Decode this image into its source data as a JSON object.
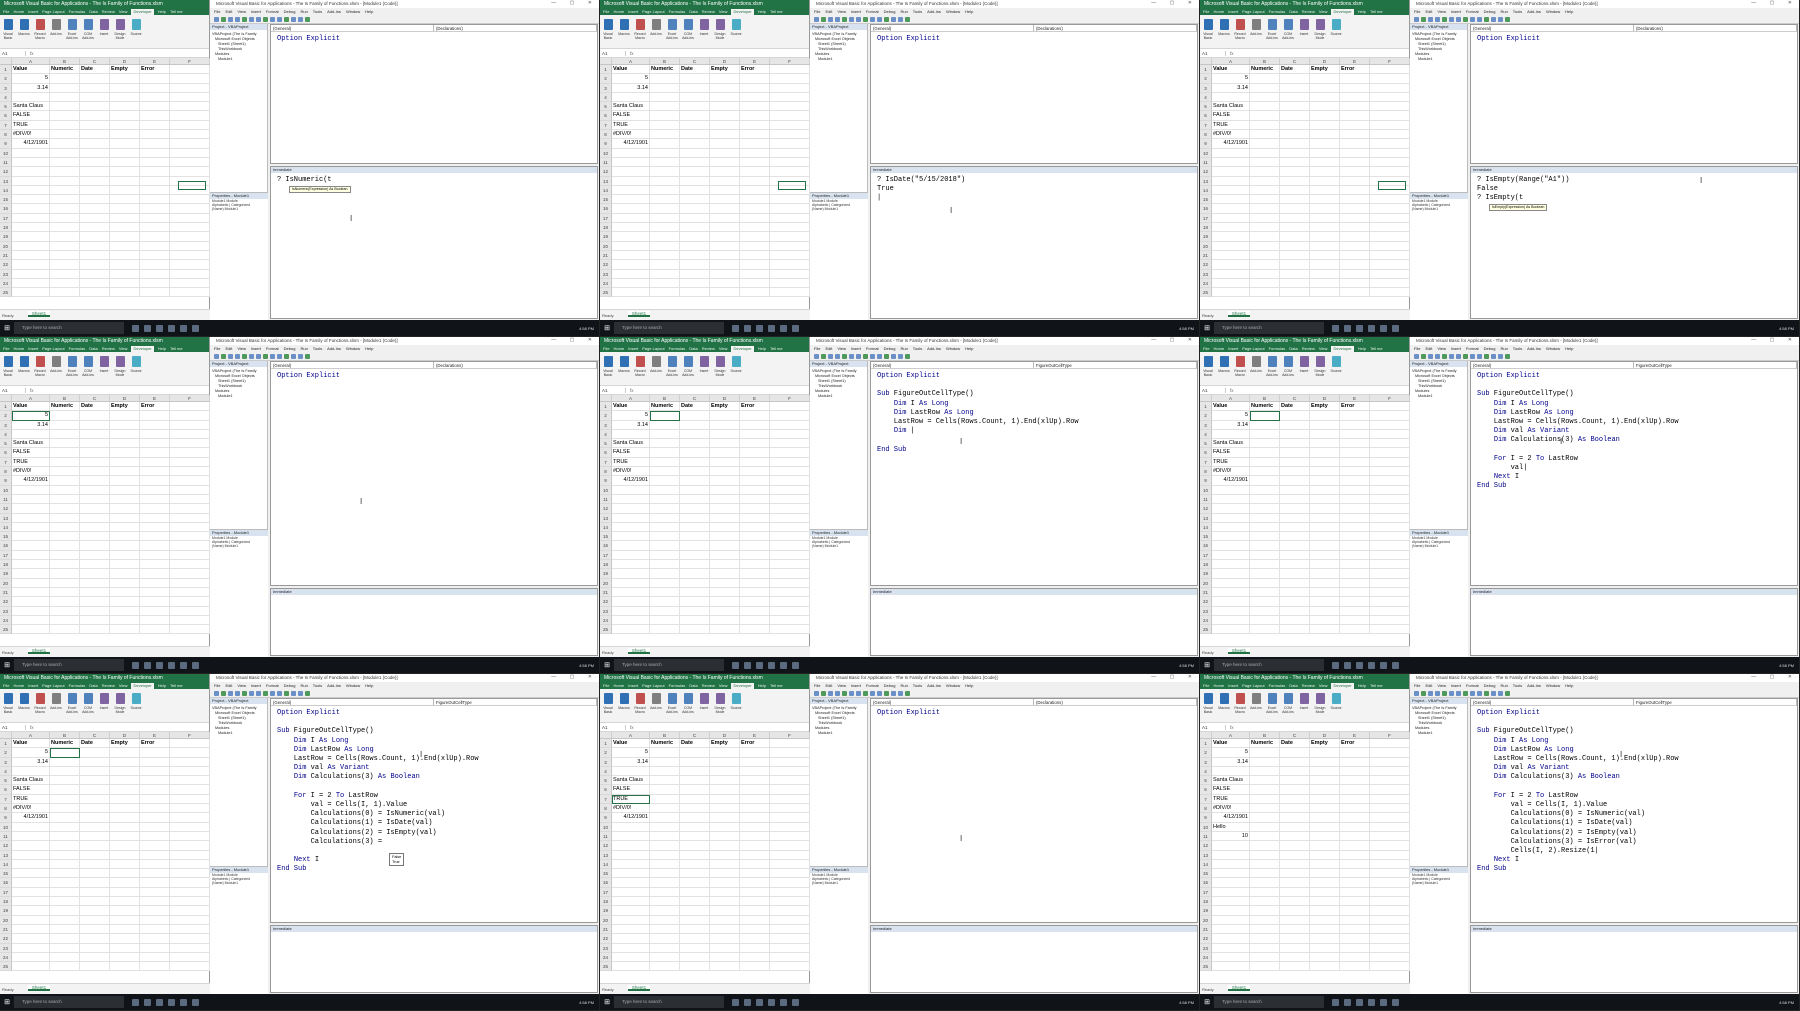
{
  "excel": {
    "title": "Microsoft Visual Basic for Applications - The Is Family of Functions.xlsm",
    "tabs": [
      "File",
      "Home",
      "Insert",
      "Page Layout",
      "Formulas",
      "Data",
      "Review",
      "View",
      "Developer",
      "Help",
      "Tell me"
    ],
    "ribbon": [
      "Visual Basic",
      "Macros",
      "Record Macro",
      "Add-ins",
      "Excel Add-ins",
      "COM Add-ins",
      "Insert",
      "Design Mode",
      "Source"
    ],
    "columns": [
      "A",
      "B",
      "C",
      "D",
      "E",
      "F"
    ],
    "headers": [
      "Value",
      "Numeric",
      "Date",
      "Empty",
      "Error"
    ],
    "values": [
      "5",
      "3.14",
      "",
      "Santa Claus",
      "FALSE",
      "TRUE",
      "#DIV/0!",
      "4/12/1901"
    ],
    "row_numbers": [
      "1",
      "2",
      "3",
      "4",
      "5",
      "6",
      "7",
      "8",
      "9",
      "10",
      "11",
      "12",
      "13",
      "14",
      "15",
      "16",
      "17",
      "18",
      "19",
      "20",
      "21",
      "22",
      "23",
      "24",
      "25"
    ],
    "sheet_tab": "Sheet1",
    "status": "Ready",
    "extra_hello": "Hello",
    "extra_ten": "10"
  },
  "vba": {
    "title": "Microsoft Visual Basic for Applications - The Is Family of Functions.xlsm - [Module1 (Code)]",
    "menu": [
      "File",
      "Edit",
      "View",
      "Insert",
      "Format",
      "Debug",
      "Run",
      "Tools",
      "Add-Ins",
      "Window",
      "Help"
    ],
    "project_header": "Project - VBAProject",
    "tree": [
      "VBAProject (The Is Family",
      "Microsoft Excel Objects",
      "Sheet1 (Sheet1)",
      "ThisWorkbook",
      "Modules",
      "Module1"
    ],
    "properties_header": "Properties - Module1",
    "properties_name": "Module1 Module",
    "properties_tabs": "Alphabetic | Categorized",
    "properties_name_row": "(Name)   Module1",
    "combo_general": "(General)",
    "combo_declarations": "(Declarations)",
    "combo_sub": "FigureOutCellType",
    "immediate_header": "Immediate",
    "option_explicit": "Option Explicit",
    "code_lines": [
      "Sub FigureOutCellType()",
      "    Dim I As Long",
      "    Dim LastRow As Long",
      "    LastRow = Cells(Rows.Count, 1).End(xlUp).Row",
      "    Dim val As Variant",
      "    Dim Calculations(3) As Boolean",
      "",
      "    For I = 2 To LastRow",
      "        val = Cells(I, 1).Value",
      "        Calculations(0) = IsNumeric(val)",
      "        Calculations(1) = IsDate(val)",
      "        Calculations(2) = IsEmpty(val)",
      "        Calculations(3) = IsError(val)",
      "        Cells(I, 2).Resize(1, 4).Value = Calculations",
      "    Next I",
      "End Sub"
    ],
    "imm_isnumeric": "? IsNumeric(t",
    "imm_isdate": "? IsDate(\"5/15/2018\")",
    "imm_true": "True",
    "imm_isempty_range": "? IsEmpty(Range(\"A1\"))",
    "imm_false": "False",
    "imm_isempty": "? IsEmpty(t",
    "tip_expression": "IsNumeric(Expression) As Boolean",
    "tip_expression_empty": "IsEmpty(Expression) As Boolean",
    "partial_dim": "    Dim |",
    "partial_val": "        val|",
    "partial_calc3": "        Calculations(3) =",
    "partial_resize": "        Cells(I, 2).Resize(1|",
    "ac_items": [
      "False",
      "True"
    ]
  },
  "taskbar": {
    "search": "Type here to search",
    "tray": "4:58 PM"
  }
}
